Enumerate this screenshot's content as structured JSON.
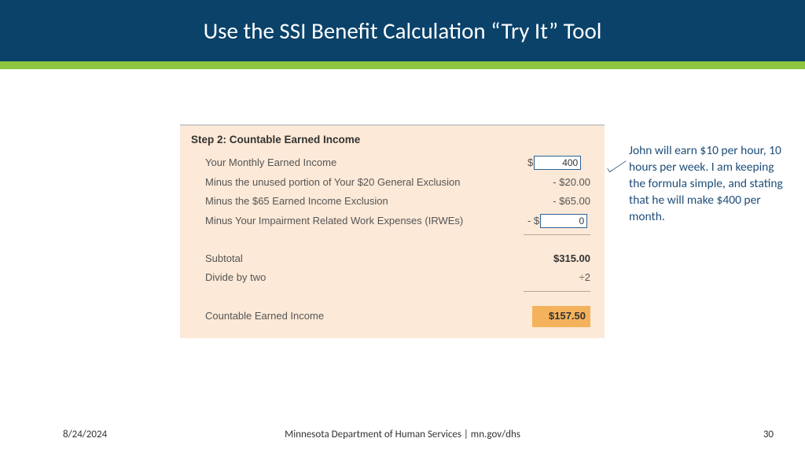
{
  "header": {
    "title": "Use the SSI Benefit Calculation “Try It” Tool"
  },
  "tool": {
    "step_title": "Step 2: Countable Earned Income",
    "r1_label": "Your Monthly Earned Income",
    "r1_prefix": "$",
    "r1_value": "400",
    "r2_label": "Minus the unused portion of Your $20 General Exclusion",
    "r2_value": "- $20.00",
    "r3_label": "Minus the $65 Earned Income Exclusion",
    "r3_value": "- $65.00",
    "r4_label": "Minus Your Impairment Related Work Expenses (IRWEs)",
    "r4_prefix": "- $",
    "r4_value": "0",
    "sub_label": "Subtotal",
    "sub_value": "$315.00",
    "div_label": "Divide by two",
    "div_value": "÷2",
    "result_label": "Countable Earned Income",
    "result_value": "$157.50"
  },
  "annotation": {
    "text": "John  will earn $10 per hour, 10 hours per week.  I am keeping the formula simple, and stating that he will make $400 per month."
  },
  "footer": {
    "date": "8/24/2024",
    "org": "Minnesota Department of Human Services  |  mn.gov/dhs",
    "page": "30"
  }
}
